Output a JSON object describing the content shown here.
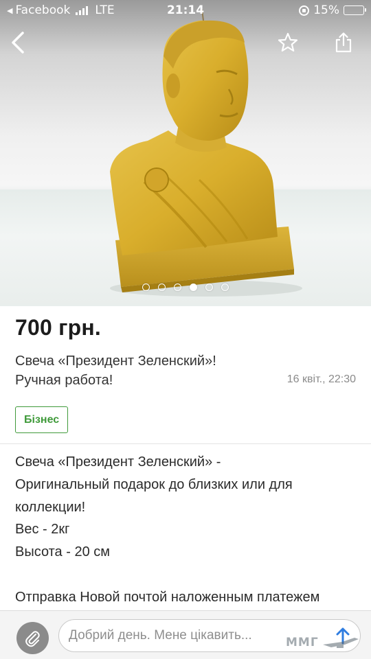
{
  "status_bar": {
    "back_app": "Facebook",
    "network": "LTE",
    "time": "21:14",
    "battery": "15%",
    "battery_level": 0.15
  },
  "gallery": {
    "photo_count": 6,
    "active_index": 3
  },
  "listing": {
    "price": "700 грн.",
    "title_line1": "Свеча «Президент Зеленский»!",
    "title_line2": "Ручная работа!",
    "date": "16 квіт., 22:30",
    "badge": "Бізнес",
    "description": [
      "Свеча «Президент Зеленский» -",
      "Оригинальный подарок до близких или для",
      "коллекции!",
      "Вес - 2кг",
      "Высота - 20 см",
      "",
      "Отправка Новой почтой наложенным платежем"
    ]
  },
  "message_bar": {
    "placeholder": "Добрий день. Мене цікавить..."
  },
  "watermark": {
    "text": "ММГ"
  },
  "icons": {
    "back": "chevron-left-icon",
    "favorite": "star-outline-icon",
    "share": "share-icon",
    "attach": "paperclip-icon",
    "send": "arrow-up-icon"
  },
  "colors": {
    "badge": "#3f9a3a",
    "send_arrow": "#2f7de0",
    "battery_fill": "#f4c300"
  }
}
